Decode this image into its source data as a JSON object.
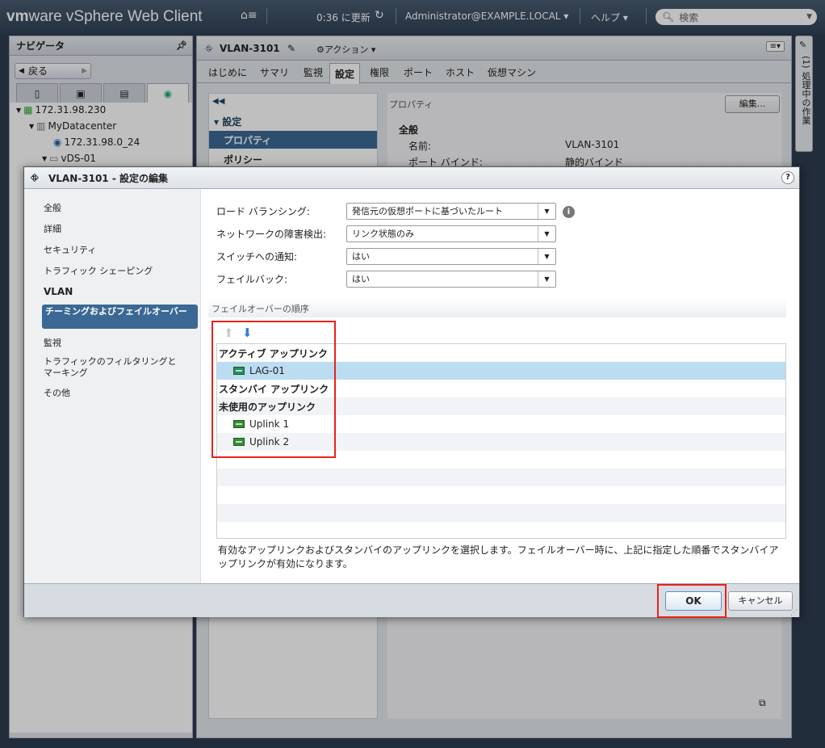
{
  "topbar": {
    "brand_vm": "vm",
    "brand_rest": "ware",
    "brand_product": " vSphere Web Client",
    "refresh_time": "0:36 に更新",
    "user": "Administrator@EXAMPLE.LOCAL",
    "help": "ヘルプ",
    "search_placeholder": "検索"
  },
  "navigator": {
    "title": "ナビゲータ",
    "back": "戻る",
    "tree": [
      "172.31.98.230",
      "MyDatacenter",
      "172.31.98.0_24",
      "vDS-01"
    ]
  },
  "main": {
    "object": "VLAN-3101",
    "actions": "アクション",
    "tabs": [
      "はじめに",
      "サマリ",
      "監視",
      "設定",
      "権限",
      "ポート",
      "ホスト",
      "仮想マシン"
    ],
    "selected_tab": "設定",
    "settings_group": "設定",
    "nav_items": [
      "プロパティ",
      "ポリシー"
    ],
    "properties_label": "プロパティ",
    "edit_button": "編集...",
    "general_label": "全般",
    "name_label": "名前:",
    "name_value": "VLAN-3101",
    "binding_label": "ポート バインド:",
    "binding_value": "静的バインド"
  },
  "side_strip": {
    "label": "(1) 処理中の作業"
  },
  "dialog": {
    "title": "VLAN-3101 - 設定の編集",
    "help_icon": "?",
    "nav": [
      "全般",
      "詳細",
      "セキュリティ",
      "トラフィック シェーピング",
      "VLAN",
      "チーミングおよびフェイルオーバー",
      "監視",
      "トラフィックのフィルタリングとマーキング",
      "その他"
    ],
    "fields": {
      "load_balancing_label": "ロード バランシング:",
      "load_balancing_value": "発信元の仮想ポートに基づいたルート",
      "failure_detection_label": "ネットワークの障害検出:",
      "failure_detection_value": "リンク状態のみ",
      "notify_label": "スイッチへの通知:",
      "notify_value": "はい",
      "failback_label": "フェイルバック:",
      "failback_value": "はい"
    },
    "failover_order_label": "フェイルオーバーの順序",
    "active_header": "アクティブ アップリンク",
    "active_items": [
      "LAG-01"
    ],
    "standby_header": "スタンバイ アップリンク",
    "unused_header": "未使用のアップリンク",
    "unused_items": [
      "Uplink 1",
      "Uplink 2"
    ],
    "description": "有効なアップリンクおよびスタンバイのアップリンクを選択します。フェイルオーバー時に、上記に指定した順番でスタンバイアップリンクが有効になります。",
    "ok": "OK",
    "cancel": "キャンセル"
  },
  "colors": {
    "highlight_red": "#e8231a",
    "selected_nav": "#3b6894",
    "selected_row": "#bcdcf2"
  }
}
